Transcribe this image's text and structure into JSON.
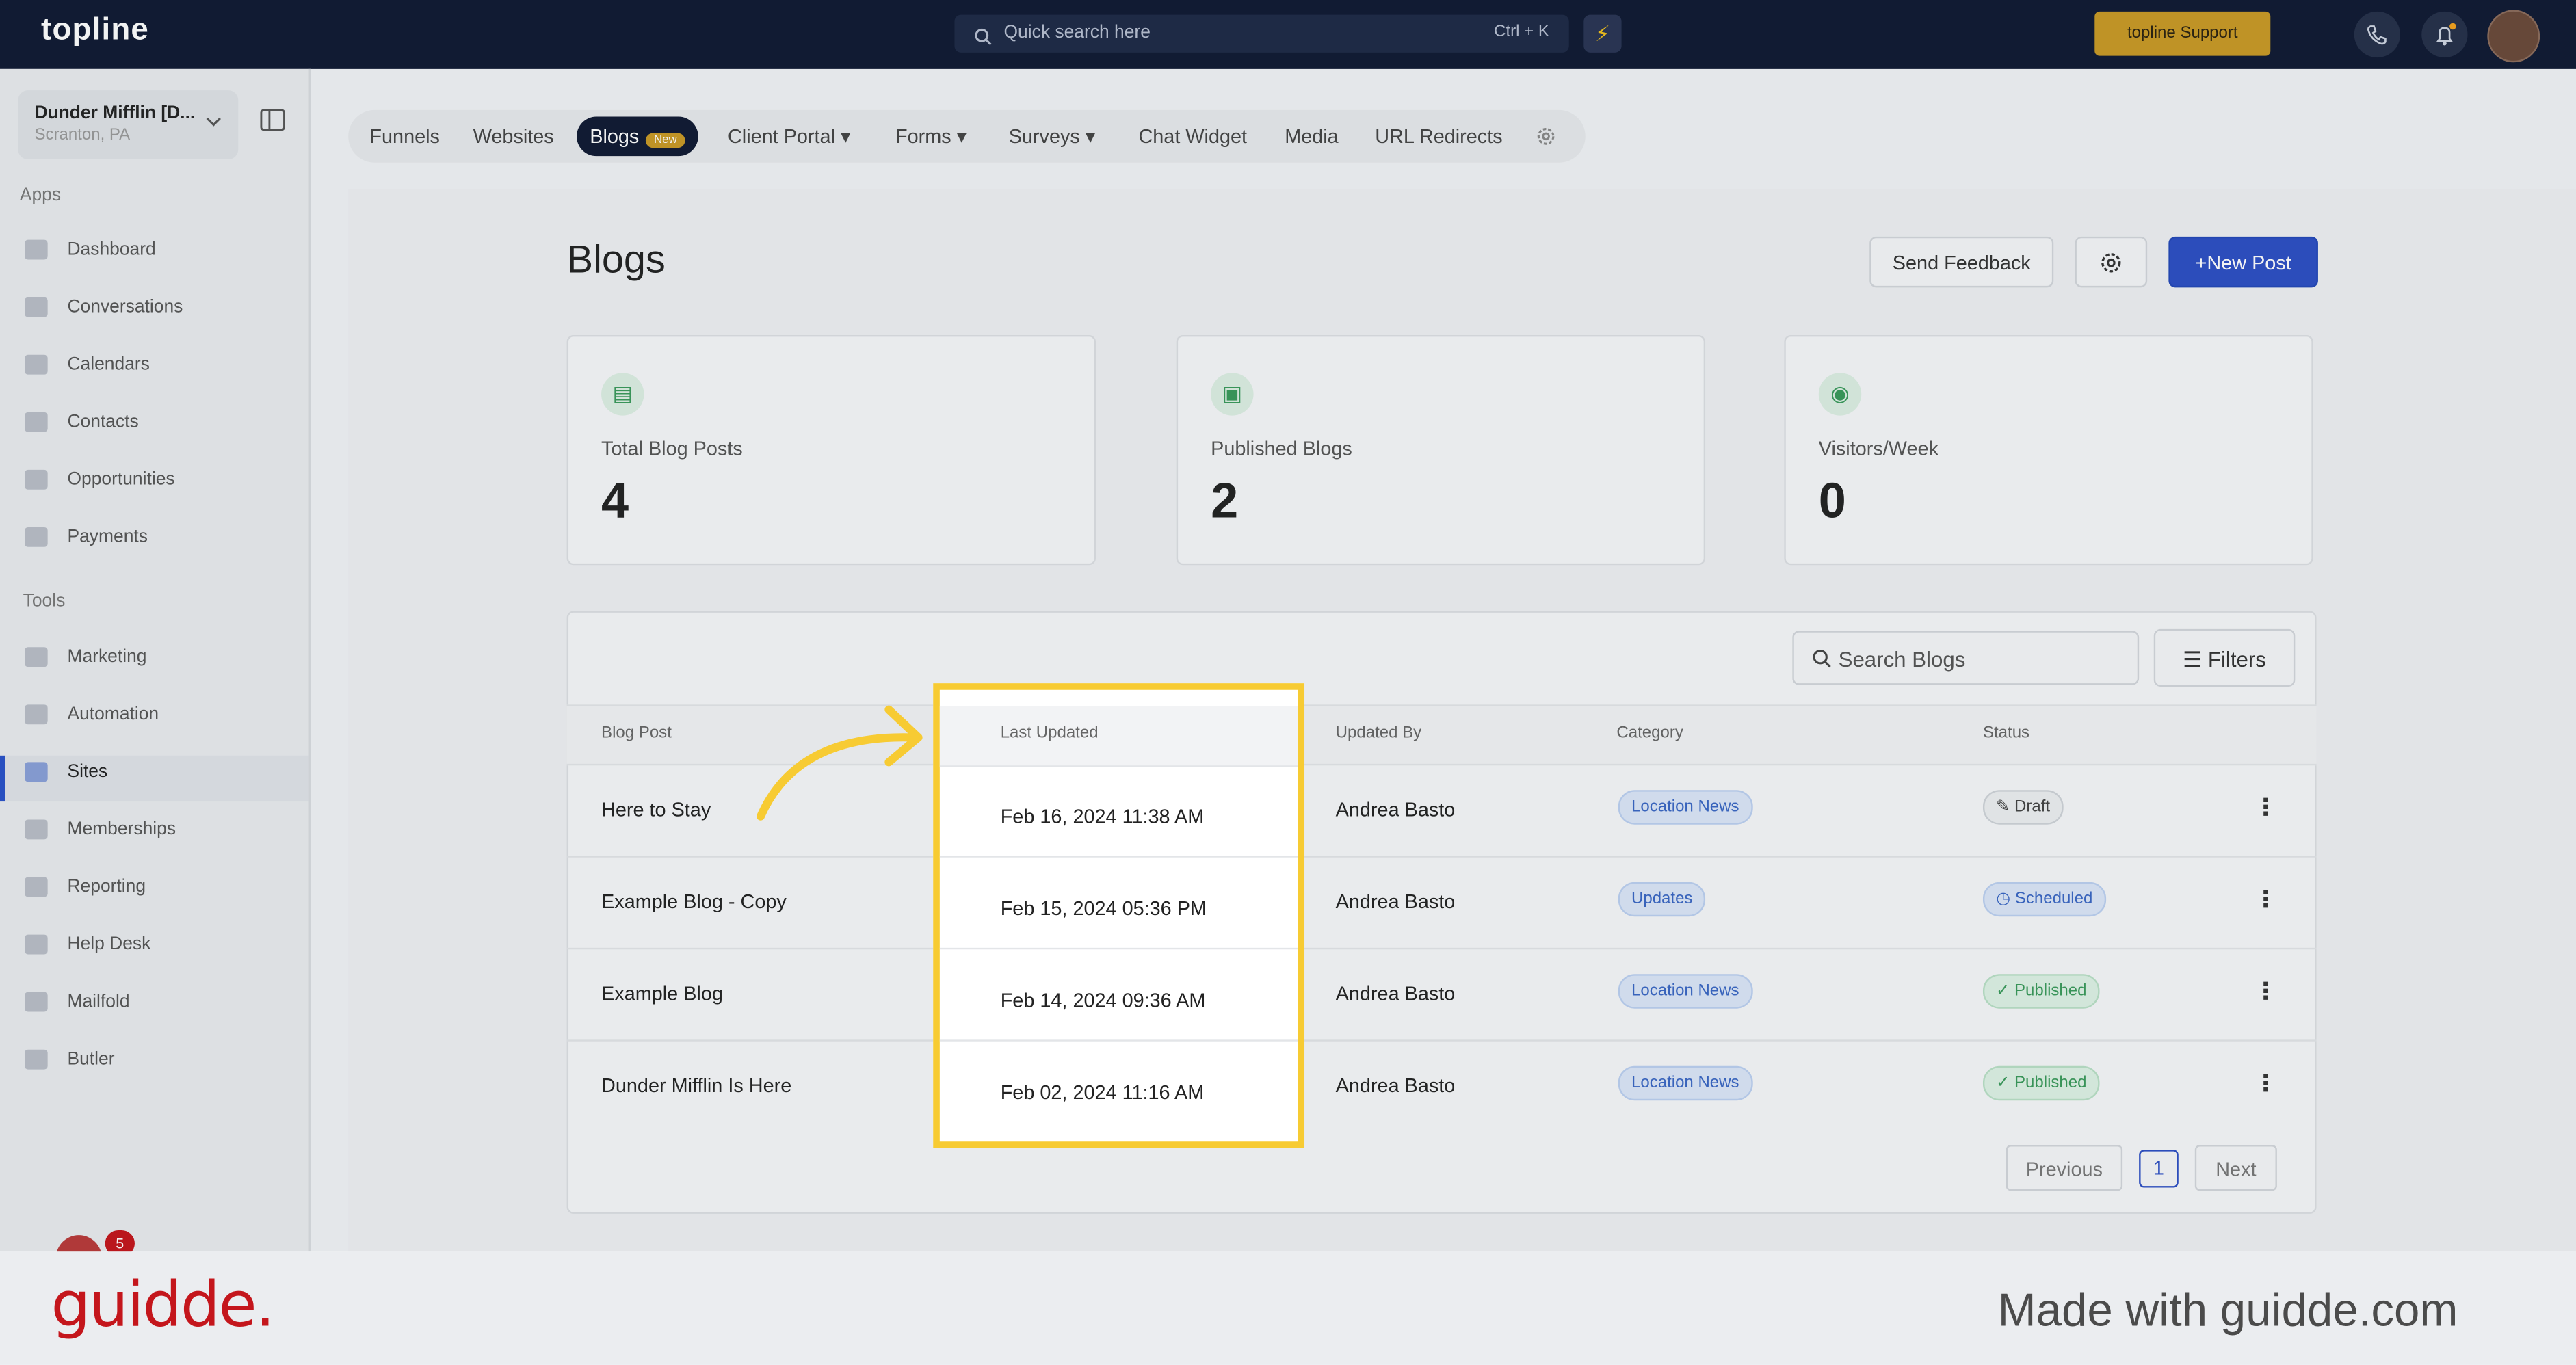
{
  "topbar": {
    "logo": "topline",
    "search_placeholder": "Quick search here",
    "search_shortcut": "Ctrl + K",
    "support_label": "topline Support"
  },
  "sidebar": {
    "location_name": "Dunder Mifflin [D...",
    "location_city": "Scranton, PA",
    "apps_label": "Apps",
    "apps": [
      "Dashboard",
      "Conversations",
      "Calendars",
      "Contacts",
      "Opportunities",
      "Payments"
    ],
    "tools_label": "Tools",
    "tools": [
      "Marketing",
      "Automation",
      "Sites",
      "Memberships",
      "Reporting",
      "Help Desk",
      "Mailfold",
      "Butler"
    ],
    "notification_count": "5"
  },
  "tabs": {
    "funnels": "Funnels",
    "websites": "Websites",
    "blogs": "Blogs",
    "blogs_badge": "New",
    "client_portal": "Client Portal",
    "forms": "Forms",
    "surveys": "Surveys",
    "chat_widget": "Chat Widget",
    "media": "Media",
    "url_redirects": "URL Redirects"
  },
  "page": {
    "title": "Blogs",
    "send_feedback": "Send Feedback",
    "new_post": "New Post"
  },
  "stats": [
    {
      "label": "Total Blog Posts",
      "value": "4"
    },
    {
      "label": "Published Blogs",
      "value": "2"
    },
    {
      "label": "Visitors/Week",
      "value": "0"
    }
  ],
  "table": {
    "search_placeholder": "Search Blogs",
    "filters_label": "Filters",
    "headers": {
      "post": "Blog Post",
      "updated": "Last Updated",
      "by": "Updated By",
      "category": "Category",
      "status": "Status"
    },
    "rows": [
      {
        "post": "Here to Stay",
        "updated": "Feb 16, 2024 11:38 AM",
        "by": "Andrea Basto",
        "category": "Location News",
        "status": "Draft"
      },
      {
        "post": "Example Blog - Copy",
        "updated": "Feb 15, 2024 05:36 PM",
        "by": "Andrea Basto",
        "category": "Updates",
        "status": "Scheduled"
      },
      {
        "post": "Example Blog",
        "updated": "Feb 14, 2024 09:36 AM",
        "by": "Andrea Basto",
        "category": "Location News",
        "status": "Published"
      },
      {
        "post": "Dunder Mifflin Is Here",
        "updated": "Feb 02, 2024 11:16 AM",
        "by": "Andrea Basto",
        "category": "Location News",
        "status": "Published"
      }
    ],
    "pagination": {
      "previous": "Previous",
      "page": "1",
      "next": "Next"
    }
  },
  "footer": {
    "logo": "guidde.",
    "tagline": "Made with guidde.com"
  },
  "colors": {
    "accent": "#2d4fc4",
    "highlight": "#f7cb33",
    "brand_footer": "#c4161c"
  }
}
